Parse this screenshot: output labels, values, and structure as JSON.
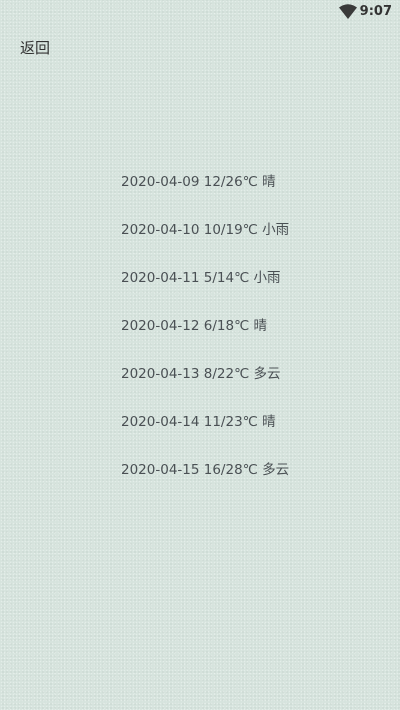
{
  "status_bar": {
    "time": "9:07",
    "wifi_icon": "wifi-icon"
  },
  "nav": {
    "back_label": "返回"
  },
  "forecast": [
    {
      "text": "2020-04-09 12/26℃ 晴"
    },
    {
      "text": "2020-04-10 10/19℃ 小雨"
    },
    {
      "text": "2020-04-11 5/14℃ 小雨"
    },
    {
      "text": "2020-04-12 6/18℃ 晴"
    },
    {
      "text": "2020-04-13 8/22℃ 多云"
    },
    {
      "text": "2020-04-14 11/23℃ 晴"
    },
    {
      "text": "2020-04-15 16/28℃ 多云"
    }
  ]
}
